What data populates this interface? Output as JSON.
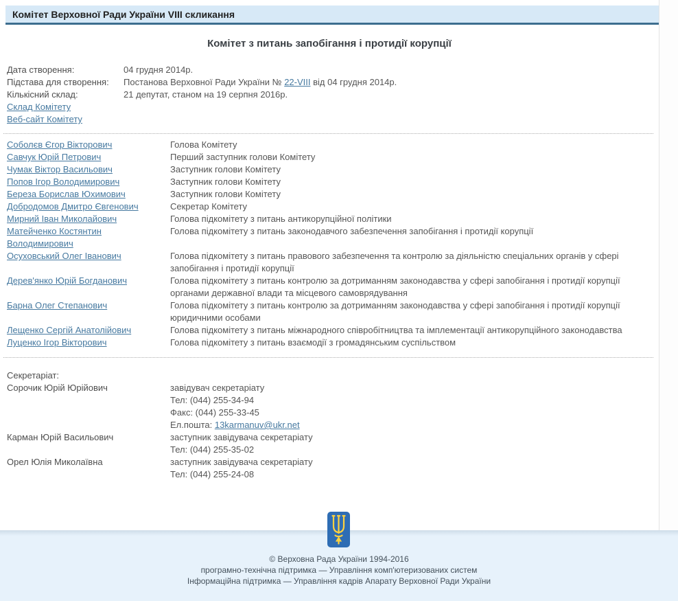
{
  "topbar": {
    "title": "Комітет Верховної Ради України VIII скликання"
  },
  "page_title": "Комітет з питань запобігання і протидії корупції",
  "info": {
    "date_label": "Дата створення:",
    "date_value": "04 грудня 2014р.",
    "basis_label": "Підстава для створення:",
    "basis_prefix": "Постанова Верховної Ради України № ",
    "basis_link": "22-VIII",
    "basis_suffix": " від 04 грудня 2014р.",
    "count_label": "Кількісний склад:",
    "count_value": "21 депутат, станом на 19 серпня 2016р.",
    "composition_link": "Склад Комітету",
    "website_link": "Веб-сайт Комітету"
  },
  "members": [
    {
      "name": "Соболєв Єгор Вікторович",
      "position": "Голова Комітету"
    },
    {
      "name": "Савчук Юрій Петрович",
      "position": "Перший заступник голови Комітету"
    },
    {
      "name": "Чумак Віктор Васильович",
      "position": "Заступник голови Комітету"
    },
    {
      "name": "Попов Ігор Володимирович",
      "position": "Заступник голови Комітету"
    },
    {
      "name": "Береза Борислав Юхимович",
      "position": "Заступник голови Комітету"
    },
    {
      "name": "Добродомов Дмитро Євгенович",
      "position": "Секретар Комітету"
    },
    {
      "name": "Мирний Іван Миколайович",
      "position": "Голова підкомітету з питань антикорупційної політики"
    },
    {
      "name": "Матейченко Костянтин Володимирович",
      "position": "Голова підкомітету з питань законодавчого забезпечення запобігання і протидії корупції"
    },
    {
      "name": "Осуховський Олег Іванович",
      "position": "Голова підкомітету з питань правового забезпечення та контролю за діяльністю спеціальних органів у сфері запобігання і протидії корупції"
    },
    {
      "name": "Дерев'янко Юрій Богданович",
      "position": "Голова підкомітету з питань контролю за дотриманням законодавства у сфері запобігання і протидії корупції органами державної влади та місцевого самоврядування"
    },
    {
      "name": "Барна Олег Степанович",
      "position": "Голова підкомітету з питань контролю за дотриманням законодавства у сфері запобігання і протидії корупції юридичними особами"
    },
    {
      "name": "Лещенко Сергій Анатолійович",
      "position": "Голова підкомітету з питань міжнародного співробітництва та імплементації антикорупційного законодавства"
    },
    {
      "name": "Луценко Ігор Вікторович",
      "position": "Голова підкомітету з питань взаємодії з громадянським суспільством"
    }
  ],
  "secretariat": {
    "title": "Секретаріат:",
    "entries": [
      {
        "name": "Сорочик Юрій Юрійович",
        "lines": [
          "завідувач секретаріату",
          "Тел: (044) 255-34-94",
          "Факс: (044) 255-33-45"
        ],
        "email_label": "Ел.пошта: ",
        "email": "13karmanuv@ukr.net"
      },
      {
        "name": "Карман Юрій Васильович",
        "lines": [
          "заступник завідувача секретаріату",
          "Тел: (044) 255-35-02"
        ]
      },
      {
        "name": "Орел Юлія Миколаївна",
        "lines": [
          "заступник завідувача секретаріату",
          "Тел: (044) 255-24-08"
        ]
      }
    ]
  },
  "footer": {
    "logo": "ukraine-trident",
    "copyright": "© Верховна Рада України 1994-2016",
    "tech_support": "програмно-технічна підтримка — Управління комп'ютеризованих систем",
    "info_support": "Інформаційна підтримка — Управління кадрів Апарату Верховної Ради України"
  },
  "colors": {
    "topbar_bg": "#d7e9f7",
    "topbar_border": "#3d6e8f",
    "link": "#4679a0",
    "footer_bg": "#e7f2fb",
    "logo_blue": "#2e6db4",
    "logo_yellow": "#ffd23f"
  }
}
